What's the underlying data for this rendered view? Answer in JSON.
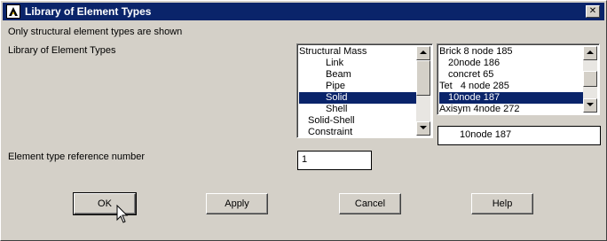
{
  "window": {
    "title": "Library of Element Types",
    "close_glyph": "✕"
  },
  "notice": "Only structural element types are shown",
  "library_label": "Library of Element Types",
  "category_list": {
    "items": [
      {
        "label": "Structural Mass",
        "indent": 0
      },
      {
        "label": "Link",
        "indent": 3
      },
      {
        "label": "Beam",
        "indent": 3
      },
      {
        "label": "Pipe",
        "indent": 3
      },
      {
        "label": "Solid",
        "indent": 3
      },
      {
        "label": "Shell",
        "indent": 3
      },
      {
        "label": "Solid-Shell",
        "indent": 1
      },
      {
        "label": "Constraint",
        "indent": 1
      }
    ],
    "selected": "Solid"
  },
  "type_list": {
    "items": [
      {
        "label": "Brick 8 node 185",
        "indent": 0
      },
      {
        "label": "20node 186",
        "indent": 1
      },
      {
        "label": "concret 65",
        "indent": 1
      },
      {
        "label": "Tet   4 node 285",
        "indent": 0
      },
      {
        "label": "10node 187",
        "indent": 1
      },
      {
        "label": "Axisym 4node 272",
        "indent": 0
      }
    ],
    "selected": "10node 187"
  },
  "selected_display": "10node 187",
  "ref_number_label": "Element type reference number",
  "ref_number_value": "1",
  "buttons": {
    "ok": "OK",
    "apply": "Apply",
    "cancel": "Cancel",
    "help": "Help"
  },
  "colors": {
    "title_bar": "#0a246a",
    "selection": "#0a246a",
    "face": "#d4d0c8"
  }
}
